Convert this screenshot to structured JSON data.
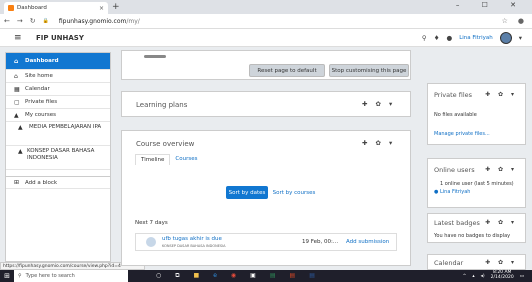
{
  "browser": {
    "tab_title": "Dashboard",
    "tab_close": "×",
    "new_tab": "+",
    "url_host": "fipunhasy.gnomio.com",
    "url_path": "/my/",
    "window_controls": "– ☐ ✕"
  },
  "navbar": {
    "site_name": "FIP UNHASY",
    "user_name": "Lina Fitriyah"
  },
  "sidebar": {
    "items": [
      {
        "label": "Dashboard",
        "icon": "dashboard-icon"
      },
      {
        "label": "Site home",
        "icon": "home-icon"
      },
      {
        "label": "Calendar",
        "icon": "calendar-icon"
      },
      {
        "label": "Private files",
        "icon": "file-icon"
      },
      {
        "label": "My courses",
        "icon": "graduation-cap-icon"
      },
      {
        "label": "MEDIA PEMBELAJARAN IPA",
        "icon": "graduation-cap-icon"
      },
      {
        "label": "KONSEP DASAR BAHASA INDONESIA",
        "icon": "graduation-cap-icon"
      }
    ],
    "add_block": "Add a block"
  },
  "status_url": "https://fipunhasy.gnomio.com/course/view.php?id=4",
  "main": {
    "reset_button": "Reset page to default",
    "stop_button": "Stop customising this page",
    "learning_plans": "Learning plans",
    "course_overview": "Course overview",
    "tabs": [
      "Timeline",
      "Courses"
    ],
    "sort_dates": "Sort by dates",
    "sort_courses": "Sort by courses",
    "next_days": "Next 7 days",
    "event": {
      "title": "ufb tugas akhir is due",
      "course": "KONSEP DASAR BAHASA INDONESIA",
      "date": "19 Feb, 00:...",
      "action": "Add submission"
    }
  },
  "right": {
    "private_files": {
      "title": "Private files",
      "text": "No files available",
      "link": "Manage private files..."
    },
    "online_users": {
      "title": "Online users",
      "text": "1 online user (last 5 minutes)",
      "user": "Lina Fitriyah"
    },
    "latest_badges": {
      "title": "Latest badges",
      "text": "You have no badges to display"
    },
    "calendar": {
      "title": "Calendar"
    }
  },
  "controls": "✚ ✿ ▾",
  "taskbar": {
    "search_placeholder": "Type here to search",
    "time": "8:20 AM",
    "date": "2/14/2020"
  },
  "colors": {
    "accent": "#1177d1",
    "brand": "#f98012"
  }
}
